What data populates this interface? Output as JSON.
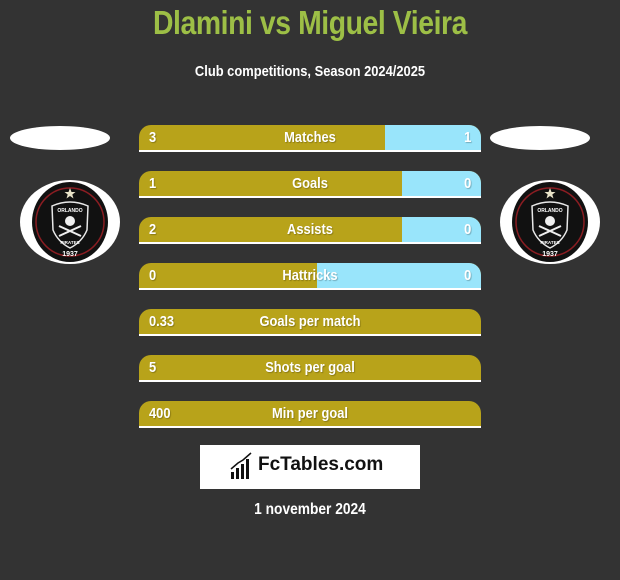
{
  "header": {
    "title": "Dlamini vs Miguel Vieira",
    "subtitle": "Club competitions, Season 2024/2025"
  },
  "players": {
    "left": {
      "badge_icon": "orlando-pirates-crest-icon",
      "badge_text_top": "ORLANDO",
      "badge_text_bottom": "PIRATES",
      "badge_year": "1937"
    },
    "right": {
      "badge_icon": "orlando-pirates-crest-icon",
      "badge_text_top": "ORLANDO",
      "badge_text_bottom": "PIRATES",
      "badge_year": "1937"
    }
  },
  "colors": {
    "title": "#9dbf46",
    "left_bar": "#b8a31a",
    "right_bar": "#99e5fb",
    "background": "#333333"
  },
  "stats": [
    {
      "label": "Matches",
      "left": "3",
      "right": "1",
      "left_share": 0.72
    },
    {
      "label": "Goals",
      "left": "1",
      "right": "0",
      "left_share": 0.77
    },
    {
      "label": "Assists",
      "left": "2",
      "right": "0",
      "left_share": 0.77
    },
    {
      "label": "Hattricks",
      "left": "0",
      "right": "0",
      "left_share": 0.52
    },
    {
      "label": "Goals per match",
      "left": "0.33",
      "right": "",
      "left_share": 1.0
    },
    {
      "label": "Shots per goal",
      "left": "5",
      "right": "",
      "left_share": 1.0
    },
    {
      "label": "Min per goal",
      "left": "400",
      "right": "",
      "left_share": 1.0
    }
  ],
  "footer": {
    "logo_text": "FcTables.com",
    "date": "1 november 2024"
  }
}
